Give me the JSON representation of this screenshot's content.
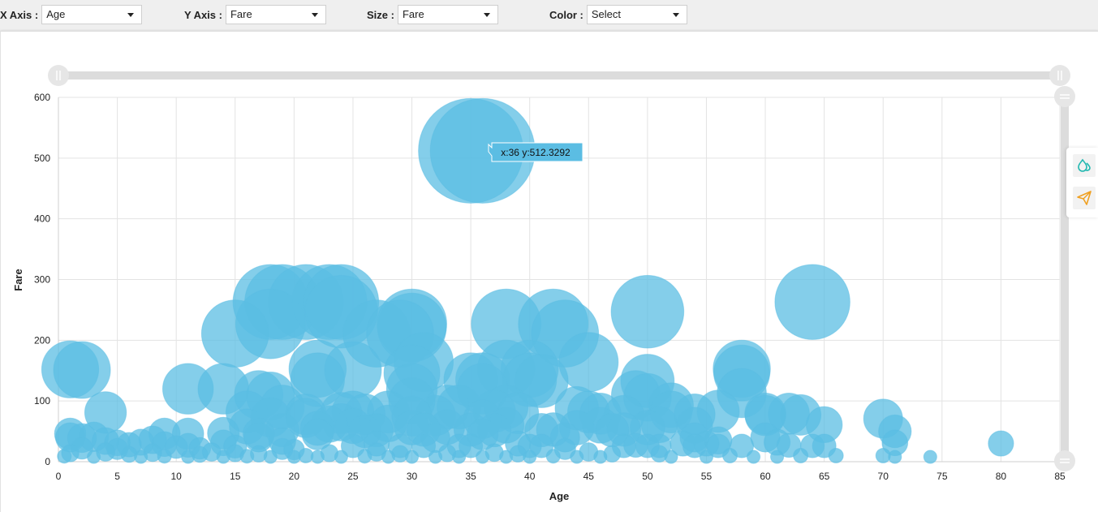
{
  "controls": {
    "x_axis": {
      "label": "X Axis :",
      "value": "Age"
    },
    "y_axis": {
      "label": "Y Axis :",
      "value": "Fare"
    },
    "size": {
      "label": "Size :",
      "value": "Fare"
    },
    "color": {
      "label": "Color :",
      "value": "Select"
    }
  },
  "tooltip": {
    "text": "x:36 y:512.3292"
  },
  "colors": {
    "bubble": "#5bbde3",
    "slider": "#d8d8d8",
    "tooltip_bg": "#5bbde3",
    "tool_teal": "#21b8b0",
    "tool_orange": "#f0a020"
  },
  "icons": {
    "theme": "color-drop-icon",
    "send": "paper-plane-icon"
  },
  "chart_data": {
    "type": "scatter",
    "xlabel": "Age",
    "ylabel": "Fare",
    "xlim": [
      0,
      85
    ],
    "ylim": [
      0,
      600
    ],
    "x_ticks": [
      "0",
      "5",
      "10",
      "15",
      "20",
      "25",
      "30",
      "35",
      "40",
      "45",
      "50",
      "55",
      "60",
      "65",
      "70",
      "75",
      "80",
      "85"
    ],
    "y_ticks": [
      "0",
      "100",
      "200",
      "300",
      "400",
      "500",
      "600"
    ],
    "grid": true,
    "series": [
      {
        "points": [
          [
            35,
            512
          ],
          [
            36,
            512
          ],
          [
            1,
            152
          ],
          [
            2,
            151
          ],
          [
            4,
            81
          ],
          [
            11,
            120
          ],
          [
            14,
            120
          ],
          [
            15,
            211
          ],
          [
            17,
            110
          ],
          [
            18,
            108
          ],
          [
            18,
            227
          ],
          [
            18,
            263
          ],
          [
            19,
            263
          ],
          [
            19,
            90
          ],
          [
            21,
            263
          ],
          [
            22,
            153
          ],
          [
            22,
            135
          ],
          [
            23,
            263
          ],
          [
            24,
            263
          ],
          [
            24,
            247
          ],
          [
            25,
            151
          ],
          [
            27,
            211
          ],
          [
            29,
            211
          ],
          [
            30,
            227
          ],
          [
            30,
            221
          ],
          [
            30,
            146
          ],
          [
            31,
            164
          ],
          [
            30,
            120
          ],
          [
            30,
            100
          ],
          [
            34,
            90
          ],
          [
            35,
            135
          ],
          [
            36,
            135
          ],
          [
            36,
            120
          ],
          [
            38,
            227
          ],
          [
            38,
            153
          ],
          [
            40,
            153
          ],
          [
            40,
            135
          ],
          [
            41,
            133
          ],
          [
            42,
            227
          ],
          [
            43,
            211
          ],
          [
            45,
            164
          ],
          [
            50,
            247
          ],
          [
            50,
            133
          ],
          [
            49,
            110
          ],
          [
            50,
            106
          ],
          [
            52,
            93
          ],
          [
            56,
            83
          ],
          [
            58,
            153
          ],
          [
            58,
            146
          ],
          [
            58,
            113
          ],
          [
            64,
            263
          ],
          [
            60,
            79
          ],
          [
            62,
            79
          ],
          [
            63,
            77
          ],
          [
            65,
            61
          ],
          [
            70,
            71
          ],
          [
            71,
            50
          ],
          [
            71,
            31
          ],
          [
            74,
            8
          ],
          [
            80,
            30
          ],
          [
            1,
            46
          ],
          [
            1,
            40
          ],
          [
            2,
            39
          ],
          [
            3,
            41
          ],
          [
            4,
            34
          ],
          [
            5,
            31
          ],
          [
            6,
            28
          ],
          [
            7,
            32
          ],
          [
            8,
            36
          ],
          [
            9,
            46
          ],
          [
            9,
            29
          ],
          [
            11,
            46
          ],
          [
            11,
            27
          ],
          [
            12,
            12
          ],
          [
            14,
            47
          ],
          [
            14,
            31
          ],
          [
            15,
            14
          ],
          [
            16,
            82
          ],
          [
            16,
            58
          ],
          [
            17,
            46
          ],
          [
            17,
            40
          ],
          [
            18,
            73
          ],
          [
            19,
            52
          ],
          [
            19,
            34
          ],
          [
            20,
            20
          ],
          [
            21,
            78
          ],
          [
            21,
            72
          ],
          [
            22,
            55
          ],
          [
            22,
            45
          ],
          [
            23,
            62
          ],
          [
            24,
            80
          ],
          [
            24,
            65
          ],
          [
            25,
            82
          ],
          [
            25,
            59
          ],
          [
            26,
            78
          ],
          [
            26,
            50
          ],
          [
            27,
            52
          ],
          [
            27,
            30
          ],
          [
            28,
            82
          ],
          [
            28,
            63
          ],
          [
            29,
            26
          ],
          [
            30,
            75
          ],
          [
            30,
            56
          ],
          [
            31,
            53
          ],
          [
            32,
            76
          ],
          [
            32,
            39
          ],
          [
            33,
            90
          ],
          [
            33,
            57
          ],
          [
            34,
            26
          ],
          [
            35,
            53
          ],
          [
            36,
            70
          ],
          [
            36,
            45
          ],
          [
            37,
            83
          ],
          [
            37,
            52
          ],
          [
            38,
            90
          ],
          [
            38,
            60
          ],
          [
            39,
            80
          ],
          [
            39,
            30
          ],
          [
            40,
            26
          ],
          [
            41,
            52
          ],
          [
            42,
            53
          ],
          [
            43,
            40
          ],
          [
            44,
            88
          ],
          [
            44,
            56
          ],
          [
            45,
            82
          ],
          [
            46,
            79
          ],
          [
            46,
            60
          ],
          [
            47,
            52
          ],
          [
            48,
            76
          ],
          [
            48,
            53
          ],
          [
            49,
            27
          ],
          [
            50,
            56
          ],
          [
            51,
            61
          ],
          [
            51,
            26
          ],
          [
            52,
            82
          ],
          [
            54,
            78
          ],
          [
            54,
            60
          ],
          [
            54,
            40
          ],
          [
            55,
            30
          ],
          [
            56,
            35
          ],
          [
            57,
            10
          ],
          [
            58,
            26
          ],
          [
            60,
            76
          ],
          [
            60,
            40
          ],
          [
            61,
            32
          ],
          [
            62,
            27
          ],
          [
            63,
            10
          ],
          [
            64,
            26
          ],
          [
            65,
            26
          ],
          [
            66,
            10
          ],
          [
            0.5,
            9
          ],
          [
            1,
            14
          ],
          [
            2,
            22
          ],
          [
            3,
            8
          ],
          [
            4,
            16
          ],
          [
            5,
            21
          ],
          [
            6,
            12
          ],
          [
            7,
            8
          ],
          [
            8,
            15
          ],
          [
            9,
            9
          ],
          [
            10,
            24
          ],
          [
            11,
            8
          ],
          [
            12,
            22
          ],
          [
            13,
            16
          ],
          [
            14,
            8
          ],
          [
            15,
            25
          ],
          [
            16,
            9
          ],
          [
            17,
            13
          ],
          [
            18,
            8
          ],
          [
            19,
            21
          ],
          [
            20,
            8
          ],
          [
            21,
            10
          ],
          [
            22,
            8
          ],
          [
            23,
            14
          ],
          [
            24,
            8
          ],
          [
            25,
            26
          ],
          [
            26,
            9
          ],
          [
            27,
            16
          ],
          [
            28,
            8
          ],
          [
            29,
            13
          ],
          [
            30,
            8
          ],
          [
            31,
            26
          ],
          [
            32,
            8
          ],
          [
            33,
            14
          ],
          [
            34,
            8
          ],
          [
            35,
            26
          ],
          [
            36,
            8
          ],
          [
            37,
            15
          ],
          [
            38,
            8
          ],
          [
            39,
            13
          ],
          [
            40,
            8
          ],
          [
            41,
            26
          ],
          [
            42,
            9
          ],
          [
            43,
            21
          ],
          [
            44,
            8
          ],
          [
            45,
            16
          ],
          [
            46,
            8
          ],
          [
            47,
            13
          ],
          [
            48,
            26
          ],
          [
            50,
            26
          ],
          [
            51,
            13
          ],
          [
            52,
            8
          ],
          [
            53,
            30
          ],
          [
            54,
            26
          ],
          [
            55,
            8
          ],
          [
            56,
            26
          ],
          [
            59,
            8
          ],
          [
            61,
            8
          ],
          [
            70,
            10
          ],
          [
            71,
            8
          ]
        ]
      }
    ]
  }
}
